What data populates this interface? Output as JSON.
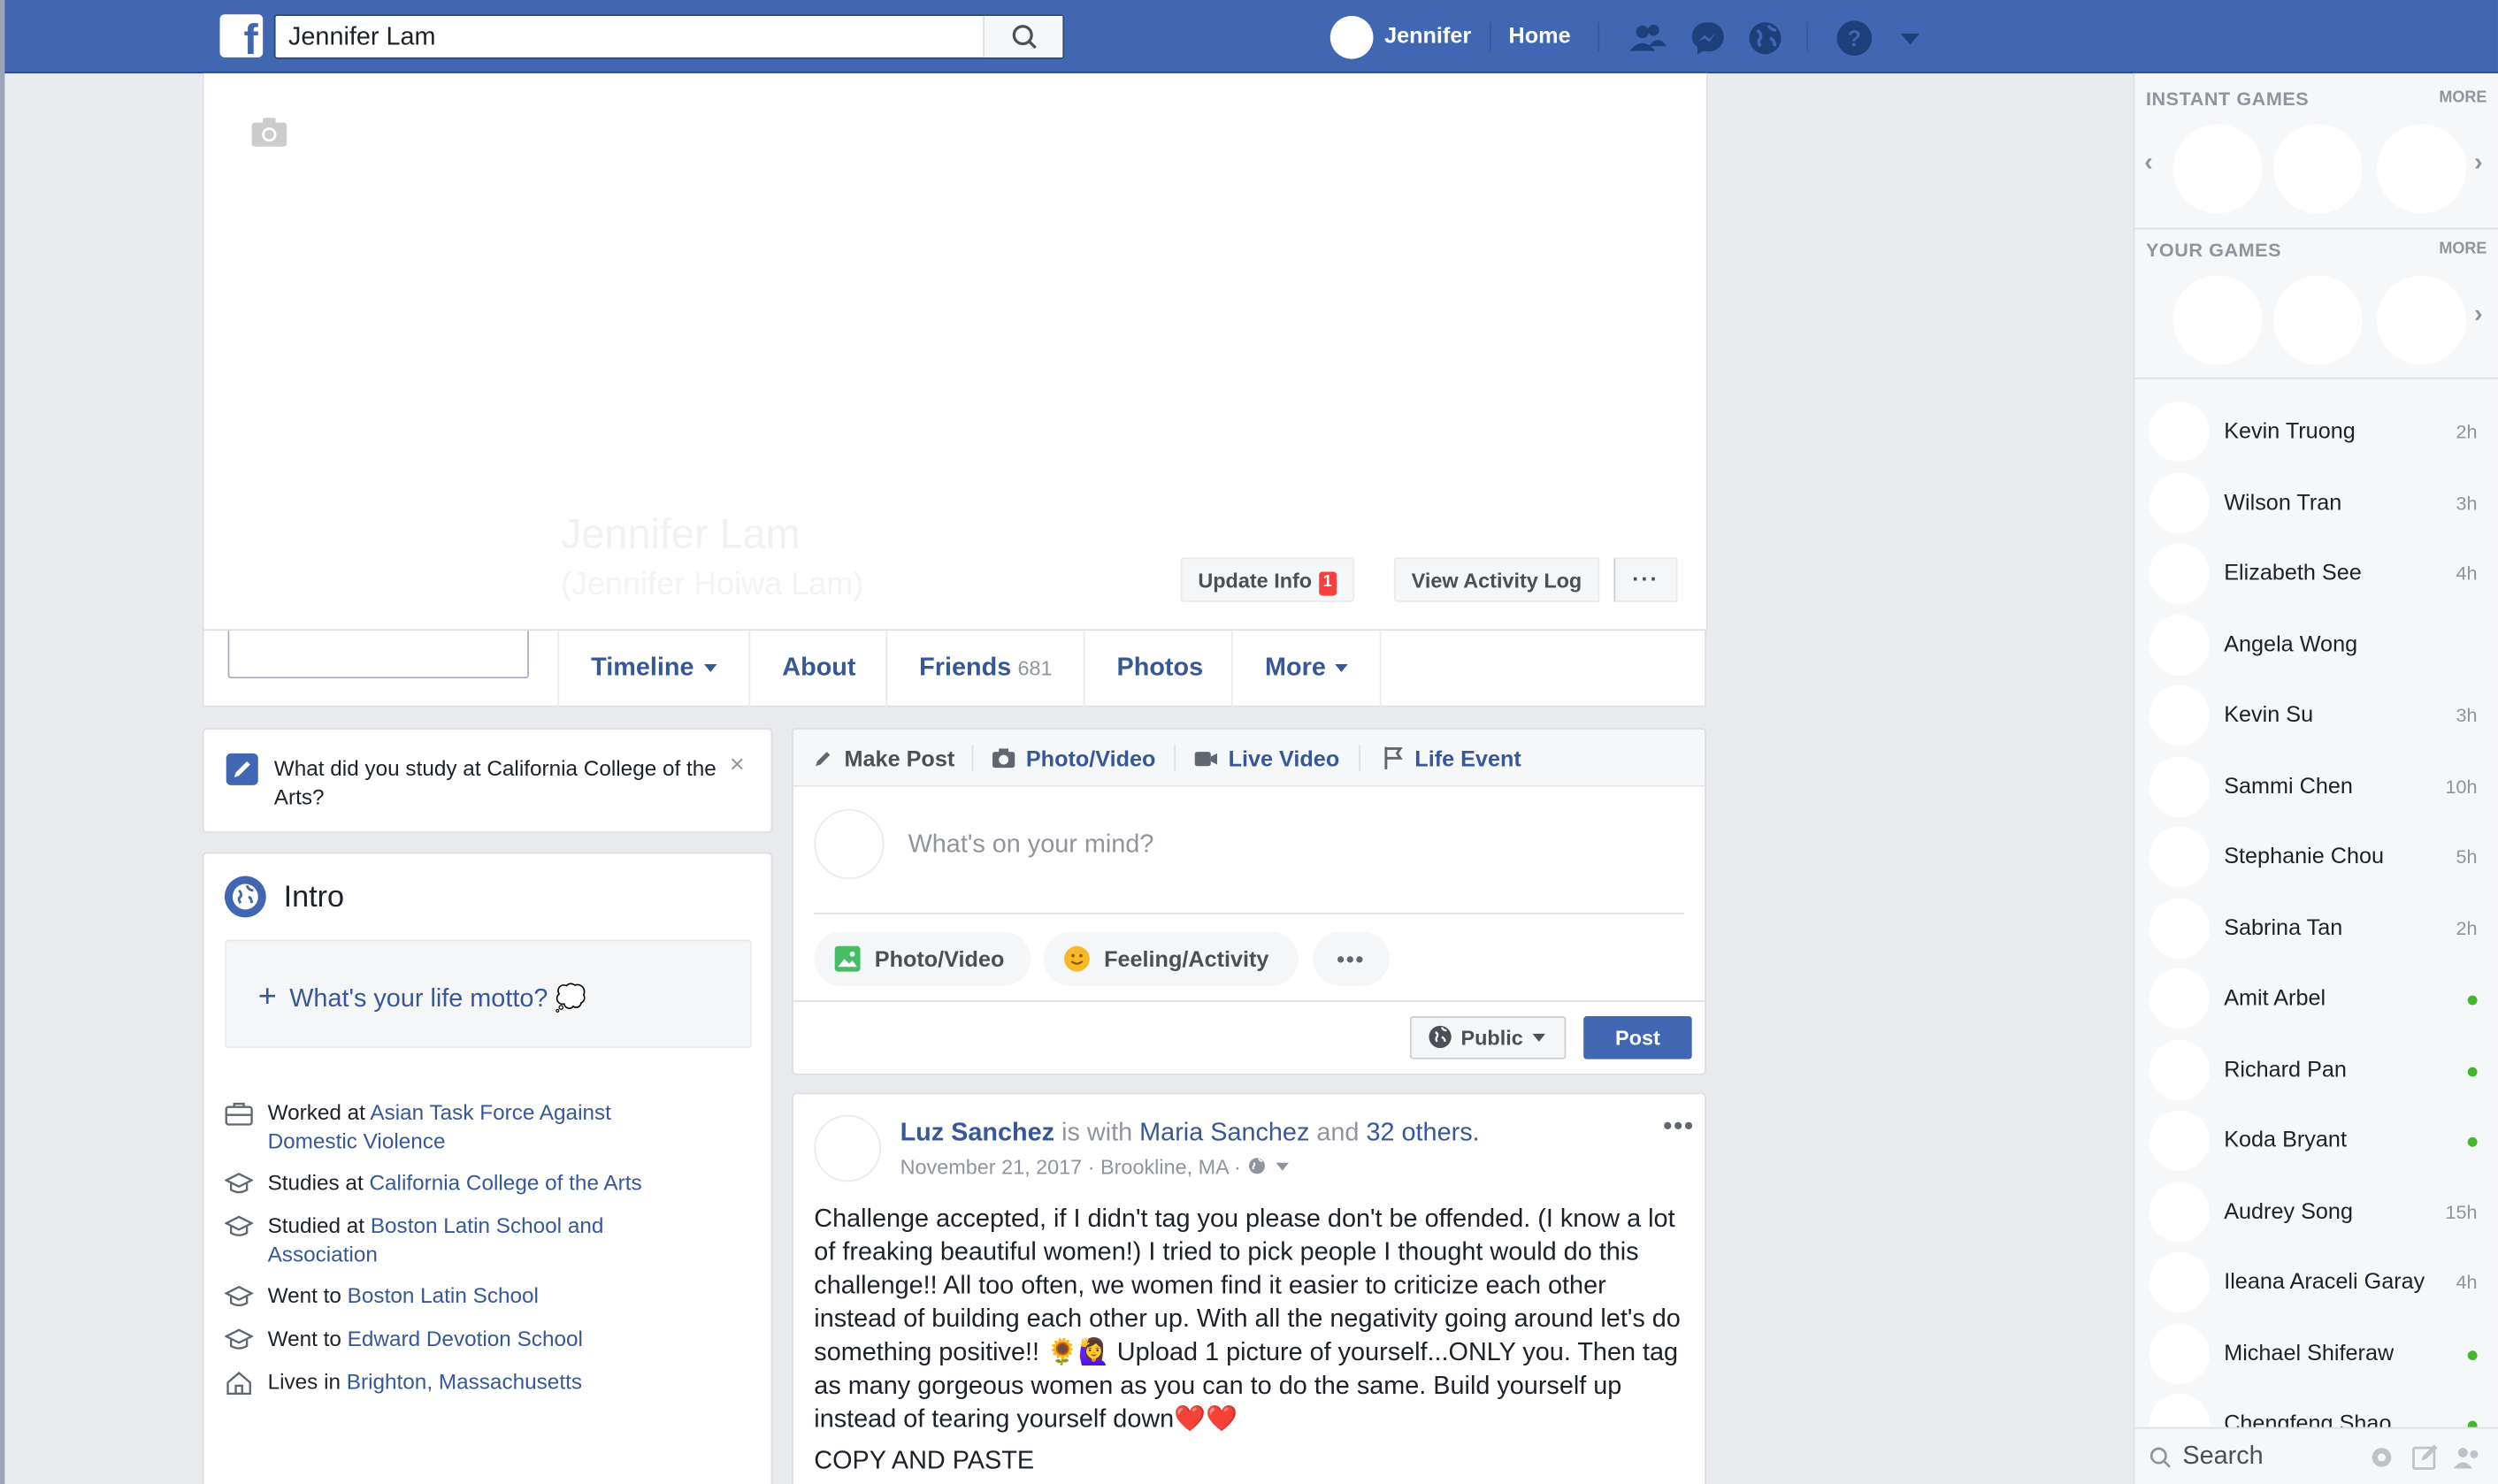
{
  "topbar": {
    "logo": "f",
    "search_value": "Jennifer Lam",
    "user_name": "Jennifer",
    "home_label": "Home"
  },
  "profile": {
    "name": "Jennifer Lam",
    "alt_name": "(Jennifer Hoiwa Lam)",
    "update_info_label": "Update Info",
    "update_info_badge": "1",
    "activity_log_label": "View Activity Log",
    "more_dots": "···"
  },
  "tabs": {
    "timeline": "Timeline",
    "about": "About",
    "friends": "Friends",
    "friends_count": "681",
    "photos": "Photos",
    "more": "More"
  },
  "study_prompt": {
    "text": "What did you study at California College of the Arts?",
    "close": "×"
  },
  "intro": {
    "title": "Intro",
    "motto_label": "What's your life motto? 💭",
    "items": [
      {
        "prefix": "Worked at ",
        "link": "Asian Task Force Against Domestic Violence",
        "icon": "briefcase-icon"
      },
      {
        "prefix": "Studies at ",
        "link": "California College of the Arts",
        "icon": "graduation-cap-icon"
      },
      {
        "prefix": "Studied at ",
        "link": "Boston Latin School and Association",
        "icon": "graduation-cap-icon"
      },
      {
        "prefix": "Went to ",
        "link": "Boston Latin School",
        "icon": "graduation-cap-icon"
      },
      {
        "prefix": "Went to ",
        "link": "Edward Devotion School",
        "icon": "graduation-cap-icon"
      },
      {
        "prefix": "Lives in ",
        "link": "Brighton, Massachusetts",
        "icon": "home-icon"
      }
    ]
  },
  "composer": {
    "tab_make_post": "Make Post",
    "tab_photo_video": "Photo/Video",
    "tab_live_video": "Live Video",
    "tab_life_event": "Life Event",
    "placeholder": "What's on your mind?",
    "pill_photo": "Photo/Video",
    "pill_feeling": "Feeling/Activity",
    "pill_more": "•••",
    "audience": "Public",
    "post_label": "Post"
  },
  "post": {
    "author": "Luz Sanchez",
    "with_text": " is with ",
    "tagged": "Maria Sanchez",
    "and_text": " and ",
    "others": "32 others.",
    "date": "November 21, 2017 · Brookline, MA · ",
    "body": "Challenge accepted, if I didn't tag you please don't be offended. (I know a lot of freaking beautiful women!) I tried to pick people I thought would do this challenge!! All too often, we women find it easier to criticize each other instead of building each other up. With all the negativity going around let's do something positive!! 🌻🙋‍♀️ Upload 1 picture of yourself...ONLY you. Then tag as many gorgeous women as you can to do the same. Build yourself up instead of tearing yourself down❤️❤️",
    "copy": "COPY AND PASTE",
    "menu": "•••"
  },
  "sidebar": {
    "instant_games": "INSTANT GAMES",
    "your_games": "YOUR GAMES",
    "more": "MORE",
    "contacts": [
      {
        "name": "Kevin Truong",
        "time": "2h",
        "online": false
      },
      {
        "name": "Wilson Tran",
        "time": "3h",
        "online": false
      },
      {
        "name": "Elizabeth See",
        "time": "4h",
        "online": false
      },
      {
        "name": "Angela Wong",
        "time": "",
        "online": false
      },
      {
        "name": "Kevin Su",
        "time": "3h",
        "online": false
      },
      {
        "name": "Sammi Chen",
        "time": "10h",
        "online": false
      },
      {
        "name": "Stephanie Chou",
        "time": "5h",
        "online": false
      },
      {
        "name": "Sabrina Tan",
        "time": "2h",
        "online": false
      },
      {
        "name": "Amit Arbel",
        "time": "",
        "online": true
      },
      {
        "name": "Richard Pan",
        "time": "",
        "online": true
      },
      {
        "name": "Koda Bryant",
        "time": "",
        "online": true
      },
      {
        "name": "Audrey Song",
        "time": "15h",
        "online": false
      },
      {
        "name": "Ileana Araceli Garay",
        "time": "4h",
        "online": false
      },
      {
        "name": "Michael Shiferaw",
        "time": "",
        "online": true
      },
      {
        "name": "Chengfeng Shao",
        "time": "",
        "online": true
      }
    ],
    "search_placeholder": "Search"
  },
  "colors": {
    "brand": "#4267b2",
    "link": "#365899",
    "online": "#42b72a",
    "badge": "#fa3e3e"
  }
}
